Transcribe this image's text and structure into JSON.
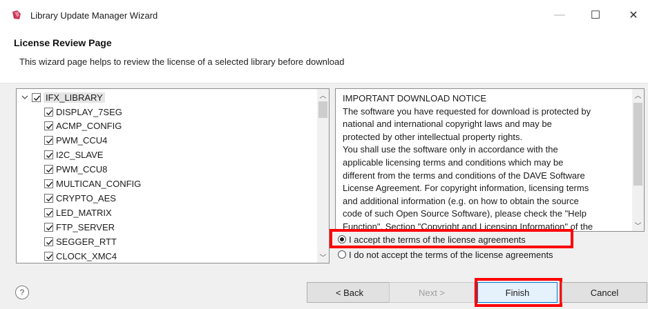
{
  "window": {
    "title": "Library Update Manager Wizard",
    "min_symbol": "—",
    "max_symbol": "☐",
    "close_symbol": "✕",
    "icon": "dave-app-icon"
  },
  "header": {
    "title": "License Review Page",
    "description": "This wizard page helps to review the license of a selected library before download"
  },
  "tree": {
    "root": {
      "label": "IFX_LIBRARY",
      "checked": true,
      "expanded": true
    },
    "items": [
      {
        "label": "DISPLAY_7SEG",
        "checked": true
      },
      {
        "label": "ACMP_CONFIG",
        "checked": true
      },
      {
        "label": "PWM_CCU4",
        "checked": true
      },
      {
        "label": "I2C_SLAVE",
        "checked": true
      },
      {
        "label": "PWM_CCU8",
        "checked": true
      },
      {
        "label": "MULTICAN_CONFIG",
        "checked": true
      },
      {
        "label": "CRYPTO_AES",
        "checked": true
      },
      {
        "label": "LED_MATRIX",
        "checked": true
      },
      {
        "label": "FTP_SERVER",
        "checked": true
      },
      {
        "label": "SEGGER_RTT",
        "checked": true
      },
      {
        "label": "CLOCK_XMC4",
        "checked": true
      }
    ]
  },
  "license": {
    "lines": [
      "IMPORTANT DOWNLOAD NOTICE",
      "The software you have requested for download is protected by",
      "national and international copyright laws and may be",
      "protected by other intellectual property rights.",
      "You shall use the software only in accordance with the",
      "applicable licensing terms and conditions which may be",
      "different from the terms and conditions of the DAVE Software",
      "License Agreement. For copyright information, licensing terms",
      "and additional information (e.g. on how to obtain the source",
      "code of such Open Source Software), please check the \"Help",
      "Function\", Section \"Copyright and Licensing Information\" of the"
    ]
  },
  "radios": {
    "accept_label": "I accept the terms of the license agreements",
    "decline_label": "I do not accept the terms of the license agreements",
    "selected": "accept"
  },
  "footer": {
    "help_symbol": "?",
    "back_label": "< Back",
    "next_label": "Next >",
    "finish_label": "Finish",
    "cancel_label": "Cancel"
  },
  "colors": {
    "highlight": "#ff0000",
    "check": "#1a1a1a",
    "panel_bg": "#f0f0f0"
  }
}
